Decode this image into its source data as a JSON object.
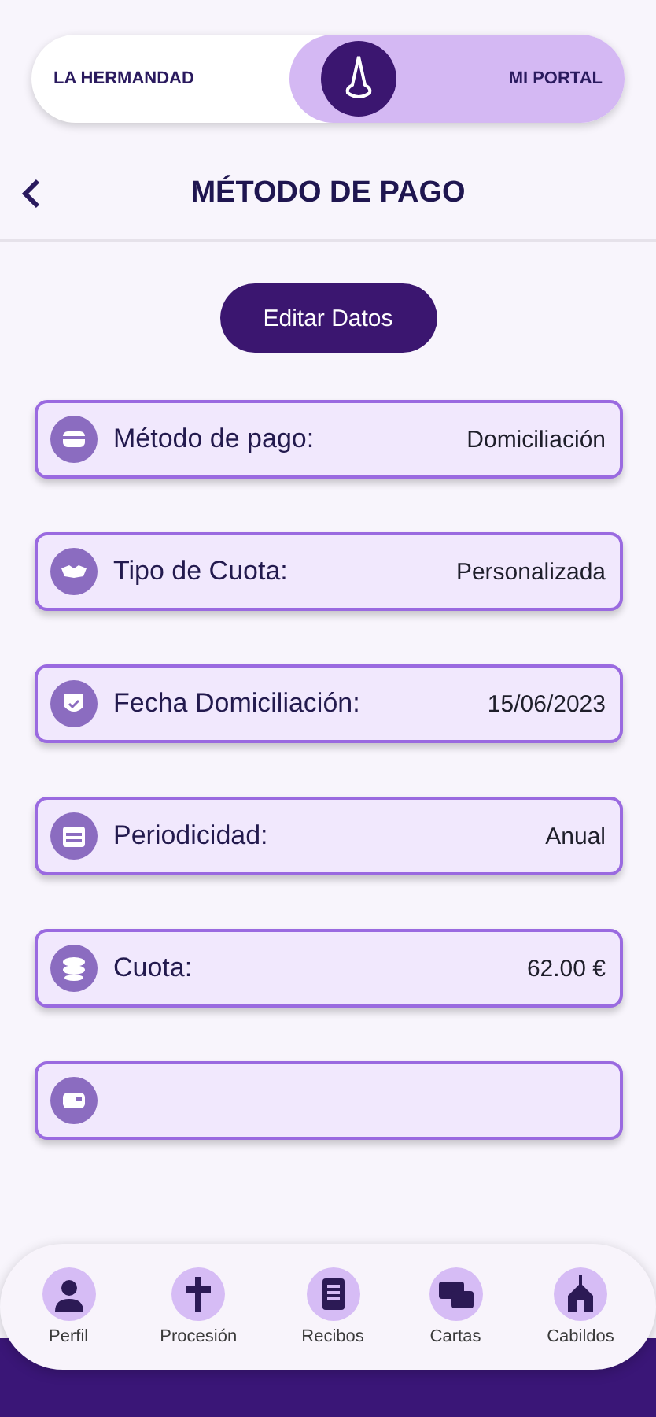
{
  "toggle": {
    "options": [
      {
        "label": "LA HERMANDAD",
        "selected": false
      },
      {
        "label": "MI PORTAL",
        "selected": true
      }
    ]
  },
  "header": {
    "title": "MÉTODO DE PAGO"
  },
  "edit_button": "Editar Datos",
  "fields": [
    {
      "kind": "detail",
      "label": "Método de pago:",
      "value": "Domiciliación"
    },
    {
      "kind": "detail",
      "label": "Tipo de Cuota:",
      "value": "Personalizada"
    },
    {
      "kind": "detail",
      "label": "Fecha Domiciliación:",
      "value": "15/06/2023"
    },
    {
      "kind": "detail",
      "label": "Periodicidad:",
      "value": "Anual"
    },
    {
      "kind": "detail",
      "label": "Cuota:",
      "value": "62.00 €"
    },
    {
      "kind": "blank"
    }
  ],
  "nav": [
    {
      "label": "Perfil"
    },
    {
      "label": "Procesión"
    },
    {
      "label": "Recibos"
    },
    {
      "label": "Cartas"
    },
    {
      "label": "Cabildos"
    }
  ]
}
